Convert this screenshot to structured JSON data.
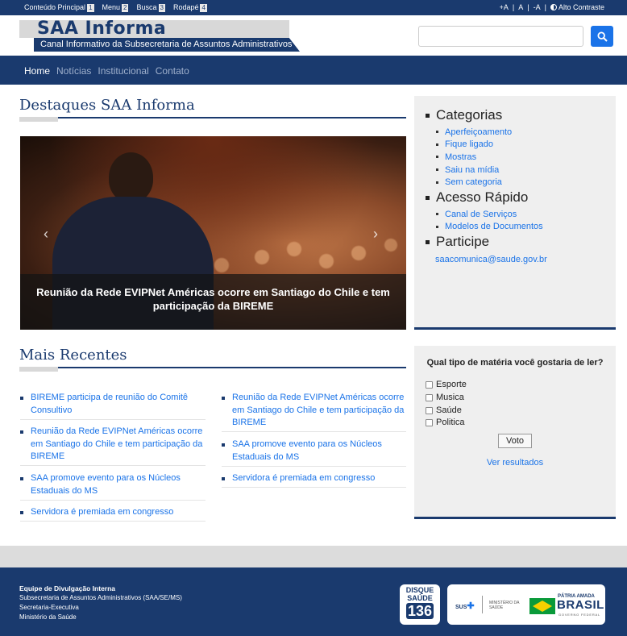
{
  "accessibility": {
    "links": [
      {
        "label": "Conteúdo Principal",
        "key": "1"
      },
      {
        "label": "Menu",
        "key": "2"
      },
      {
        "label": "Busca",
        "key": "3"
      },
      {
        "label": "Rodapé",
        "key": "4"
      }
    ],
    "font_increase": "+A",
    "font_normal": "A",
    "font_decrease": "-A",
    "separator": "|",
    "contrast": "Alto Contraste"
  },
  "header": {
    "logo_title": "SAA Informa",
    "logo_subtitle": "Canal Informativo da Subsecretaria de Assuntos Administrativos",
    "search_placeholder": ""
  },
  "nav": {
    "items": [
      "Home",
      "Notícias",
      "Institucional",
      "Contato"
    ]
  },
  "highlights": {
    "title": "Destaques SAA Informa",
    "slide_caption": "Reunião da Rede EVIPNet Américas ocorre em Santiago do Chile e tem participação da BIREME",
    "prev_arrow": "‹",
    "next_arrow": "›"
  },
  "sidebar": {
    "categories_title": "Categorias",
    "categories": [
      "Aperfeiçoamento",
      "Fique ligado",
      "Mostras",
      "Saiu na mídia",
      "Sem categoria"
    ],
    "quick_title": "Acesso Rápido",
    "quick_links": [
      "Canal de Serviços",
      "Modelos de Documentos"
    ],
    "participe_title": "Participe",
    "email": "saacomunica@saude.gov.br"
  },
  "recent": {
    "title": "Mais Recentes",
    "left": [
      "BIREME participa de reunião do Comitê Consultivo",
      "Reunião da Rede EVIPNet Américas ocorre em Santiago do Chile e tem participação da BIREME",
      "SAA promove evento para os Núcleos Estaduais do MS",
      "Servidora é premiada em congresso"
    ],
    "right": [
      "Reunião da Rede EVIPNet Américas ocorre em Santiago do Chile e tem participação da BIREME",
      "SAA promove evento para os Núcleos Estaduais do MS",
      "Servidora é premiada em congresso"
    ]
  },
  "poll": {
    "question": "Qual tipo de matéria você gostaria de ler?",
    "options": [
      "Esporte",
      "Musica",
      "Saúde",
      "Politica"
    ],
    "vote_label": "Voto",
    "results_label": "Ver resultados"
  },
  "footer": {
    "team": "Equipe de Divulgação Interna",
    "lines": [
      "Subsecretaria de Assuntos Administrativos (SAA/SE/MS)",
      "Secretaria-Executiva",
      "Ministério da Saúde"
    ],
    "disque_l1": "DISQUE",
    "disque_l2": "SAÚDE",
    "disque_number": "136",
    "sus": "SUS",
    "ministerio": [
      "MINISTÉRIO DA",
      "SAÚDE"
    ],
    "patria": "PÁTRIA AMADA",
    "brasil": "BRASIL",
    "governo": "GOVERNO FEDERAL"
  },
  "colors": {
    "brand_blue": "#1a3a6e",
    "link_blue": "#1a73e8",
    "sidebar_bg": "#efefef"
  }
}
